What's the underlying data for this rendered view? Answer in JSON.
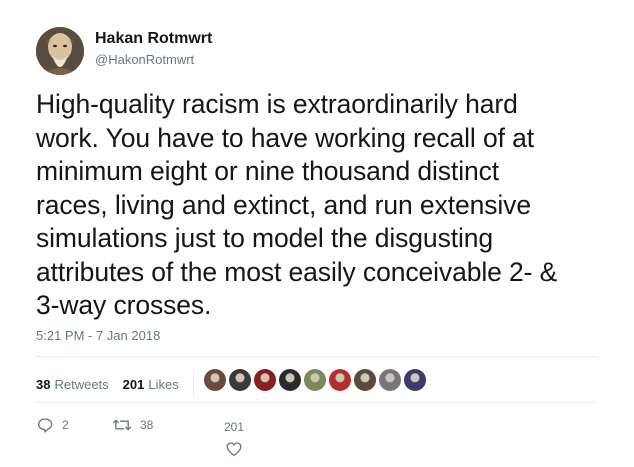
{
  "author": {
    "display_name": "Hakan Rotmwrt",
    "handle": "@HakonRotmwrt",
    "avatar_icon": "avatar-photo-icon"
  },
  "tweet": {
    "lines": [
      "High-quality racism is extraordinarily hard",
      "work. You have to have working recall of at",
      "minimum eight or nine thousand distinct",
      "races, living and extinct, and run extensive",
      "simulations just to model the disgusting",
      "attributes of the most easily conceivable 2- &",
      "3-way crosses."
    ],
    "timestamp": "5:21 PM - 7 Jan 2018"
  },
  "stats": {
    "retweets_count": "38",
    "retweets_label": "Retweets",
    "likes_count": "201",
    "likes_label": "Likes"
  },
  "likers": [
    {
      "icon": "liker-avatar-icon",
      "color": "#6b4a3a"
    },
    {
      "icon": "liker-avatar-icon",
      "color": "#3a3a3a"
    },
    {
      "icon": "liker-avatar-icon",
      "color": "#8a1f1f"
    },
    {
      "icon": "liker-avatar-icon",
      "color": "#2b2b2b"
    },
    {
      "icon": "liker-avatar-icon",
      "color": "#7a8a5a"
    },
    {
      "icon": "liker-avatar-icon",
      "color": "#b03030"
    },
    {
      "icon": "liker-avatar-icon",
      "color": "#5a4a3a"
    },
    {
      "icon": "liker-avatar-icon",
      "color": "#777777"
    },
    {
      "icon": "liker-avatar-icon",
      "color": "#3b3b6b"
    }
  ],
  "actions": {
    "reply_count": "2",
    "retweet_count": "38",
    "like_count": "201",
    "reply_icon": "reply-icon",
    "retweet_icon": "retweet-icon",
    "like_icon": "heart-icon"
  },
  "colors": {
    "text": "#14171a",
    "secondary": "#657786",
    "divider": "#e6ecf0"
  }
}
